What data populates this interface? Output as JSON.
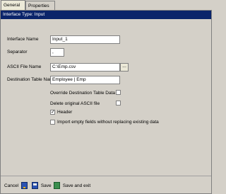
{
  "tabs": [
    {
      "label": "General"
    },
    {
      "label": "Properties"
    }
  ],
  "header": {
    "title": "Interface Type: Input"
  },
  "fields": {
    "interface_name": {
      "label": "Interface Name",
      "value": "Input_1"
    },
    "separator": {
      "label": "Separator",
      "value": ","
    },
    "ascii_file": {
      "label": "ASCII File Name",
      "value": "C:\\Emp.csv",
      "browse_label": "..."
    },
    "destination_table": {
      "label": "Destination Table Name",
      "value": "Employee  |  Emp"
    }
  },
  "checkboxes": [
    {
      "label": "Override Destination Table Data",
      "checked": false
    },
    {
      "label": "Delete original ASCII file",
      "checked": false
    },
    {
      "label": "Header",
      "checked": true
    },
    {
      "label": "Import empty fields without replacing existing data",
      "checked": false
    }
  ],
  "footer": {
    "cancel_label": "Cancel",
    "save_label": "Save",
    "save_exit_label": "Save and exit"
  }
}
